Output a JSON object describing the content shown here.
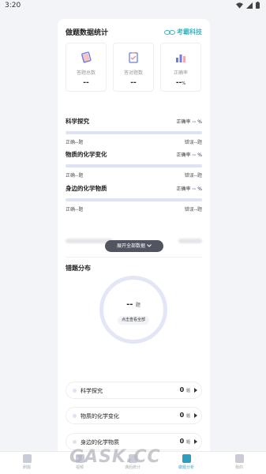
{
  "status_bar": {
    "time": "3:20"
  },
  "header": {
    "title": "做题数据统计",
    "brand": "考霸科技"
  },
  "stats": [
    {
      "label": "答题总数",
      "value": "--",
      "unit": "",
      "icon": "book-icon"
    },
    {
      "label": "答对题数",
      "value": "--",
      "unit": "",
      "icon": "clipboard-check-icon"
    },
    {
      "label": "正确率",
      "value": "--",
      "unit": "%",
      "icon": "bar-chart-icon"
    }
  ],
  "subjects": [
    {
      "name": "科学探究",
      "accuracy_label": "正确率",
      "accuracy_value": "--",
      "accuracy_unit": "%",
      "correct": "正确--题",
      "wrong": "错误--题"
    },
    {
      "name": "物质的化学变化",
      "accuracy_label": "正确率",
      "accuracy_value": "--",
      "accuracy_unit": "%",
      "correct": "正确--题",
      "wrong": "错误--题"
    },
    {
      "name": "身边的化学物质",
      "accuracy_label": "正确率",
      "accuracy_value": "--",
      "accuracy_unit": "%",
      "correct": "正确--题",
      "wrong": "错误--题"
    }
  ],
  "expand_button": "展开全部数据",
  "error_section": {
    "title": "错题分布",
    "total": "--",
    "total_unit": "题",
    "view_all": "点击查看全部"
  },
  "error_rows": [
    {
      "name": "科学探究",
      "count": "0",
      "unit": "题"
    },
    {
      "name": "物质的化学变化",
      "count": "0",
      "unit": "题"
    },
    {
      "name": "身边的化学物质",
      "count": "0",
      "unit": "题"
    }
  ],
  "tabs": [
    {
      "label": "刷题",
      "icon": "home-icon"
    },
    {
      "label": "视频",
      "icon": "video-icon"
    },
    {
      "label": "课后统计",
      "icon": "stats-icon"
    },
    {
      "label": "做题分析",
      "icon": "analysis-icon"
    },
    {
      "label": "我的",
      "icon": "user-icon"
    }
  ],
  "watermark": "GASK.CC",
  "colors": {
    "accent": "#6a7fe0",
    "brand": "#3bb7c2",
    "active_tab": "#2f9cc0"
  }
}
